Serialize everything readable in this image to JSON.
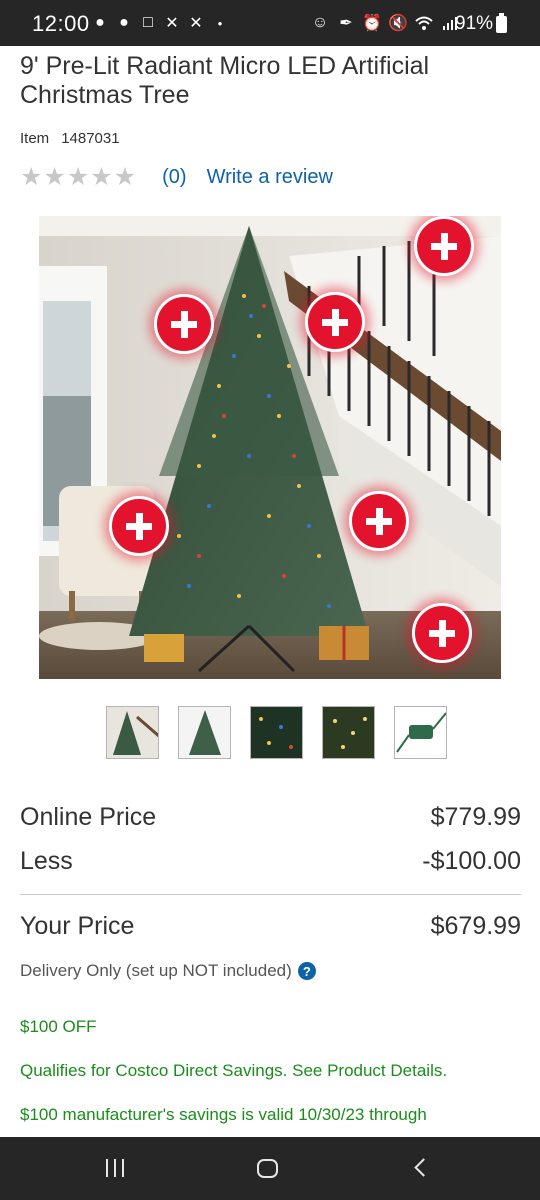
{
  "status_bar": {
    "time": "12:00",
    "left_icons": [
      "messenger-icon",
      "messenger-icon",
      "instagram-icon",
      "x-icon",
      "x-icon",
      "dot-icon"
    ],
    "right_icons": [
      "face-icon",
      "pen-icon",
      "alarm-icon",
      "mute-icon",
      "wifi-icon",
      "signal-icon"
    ],
    "battery": "91%"
  },
  "product": {
    "title": "9' Pre-Lit Radiant Micro LED Artificial Christmas Tree",
    "item_label": "Item",
    "item_number": "1487031",
    "rating": 0,
    "review_count": "(0)",
    "write_review": "Write a review"
  },
  "gallery": {
    "hotspot_count": 6,
    "thumbnails": [
      "tree-stairs-thumbnail",
      "tree-full-thumbnail",
      "lights-closeup-thumbnail",
      "warm-lights-thumbnail",
      "remote-control-thumbnail"
    ]
  },
  "pricing": {
    "online_label": "Online Price",
    "online_value": "$779.99",
    "less_label": "Less",
    "less_value": "-$100.00",
    "your_label": "Your Price",
    "your_value": "$679.99",
    "delivery_note": "Delivery Only (set up NOT included)"
  },
  "promos": {
    "off": "$100 OFF",
    "qualifies": "Qualifies for Costco Direct Savings. See Product Details.",
    "valid": "$100 manufacturer's savings is valid 10/30/23 through"
  },
  "colors": {
    "link_blue": "#0d63a8",
    "promo_green": "#1a8d1a",
    "hotspot_red": "#e3132d"
  }
}
